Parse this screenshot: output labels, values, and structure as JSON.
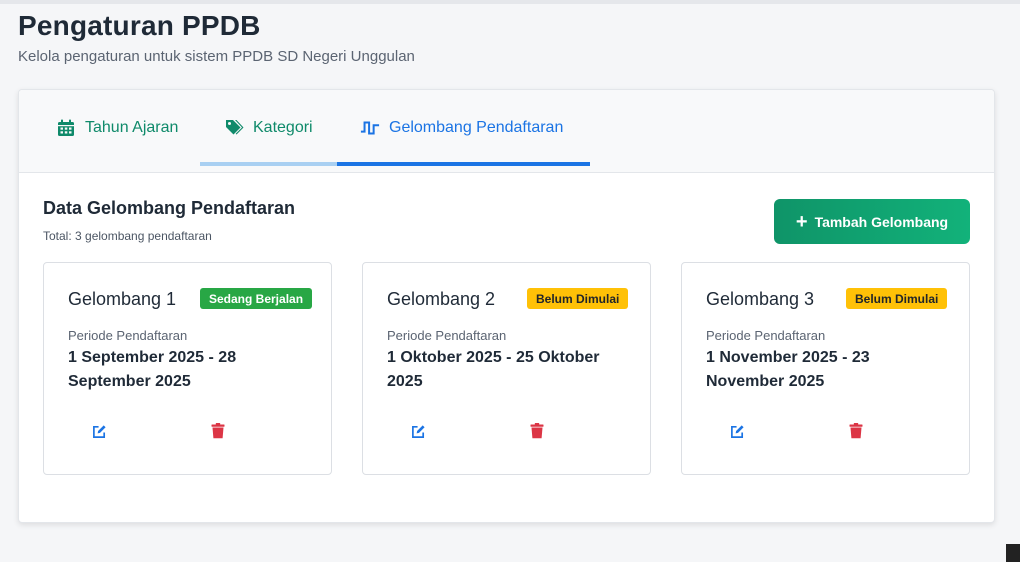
{
  "header": {
    "title": "Pengaturan PPDB",
    "subtitle": "Kelola pengaturan untuk sistem PPDB SD Negeri Unggulan"
  },
  "tabs": [
    {
      "label": "Tahun Ajaran",
      "icon": "calendar-icon",
      "active": false
    },
    {
      "label": "Kategori",
      "icon": "tag-icon",
      "active": false
    },
    {
      "label": "Gelombang Pendaftaran",
      "icon": "wave-icon",
      "active": true
    }
  ],
  "section": {
    "title": "Data Gelombang Pendaftaran",
    "count": "Total: 3 gelombang pendaftaran",
    "add_label": "Tambah Gelombang"
  },
  "cards": [
    {
      "title": "Gelombang 1",
      "badge": "Sedang Berjalan",
      "badge_color": "#28a745",
      "period_label": "Periode Pendaftaran",
      "period": "1 September 2025 - 28 September 2025"
    },
    {
      "title": "Gelombang 2",
      "badge": "Belum Dimulai",
      "badge_color": "#ffc107",
      "period_label": "Periode Pendaftaran",
      "period": "1 Oktober 2025 - 25 Oktober 2025"
    },
    {
      "title": "Gelombang 3",
      "badge": "Belum Dimulai",
      "badge_color": "#ffc107",
      "period_label": "Periode Pendaftaran",
      "period": "1 November 2025 - 23 November 2025"
    }
  ],
  "colors": {
    "accent_green": "#0f8a6a",
    "accent_blue": "#1b74e4",
    "delete_red": "#dc3545"
  }
}
